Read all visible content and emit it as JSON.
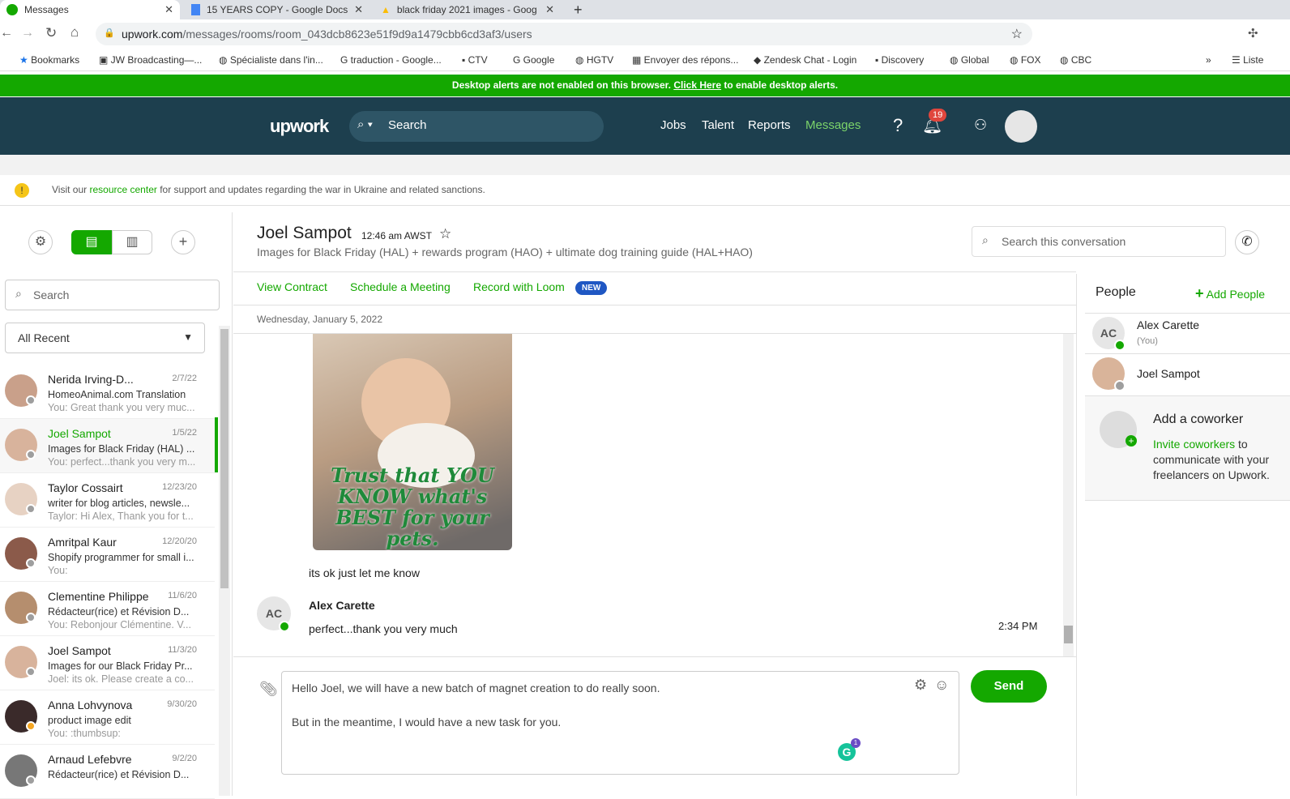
{
  "browser": {
    "tabs": [
      {
        "title": "Messages"
      },
      {
        "title": "15 YEARS COPY - Google Docs"
      },
      {
        "title": "black friday 2021 images - Goog"
      }
    ],
    "url_domain": "upwork.com",
    "url_path": "/messages/rooms/room_043dcb8623e51f9d9a1479cbb6cd3af3/users",
    "bookmarks": [
      "Bookmarks",
      "JW Broadcasting—...",
      "Spécialiste dans l'in...",
      "traduction - Google...",
      "CTV",
      "Google",
      "HGTV",
      "Envoyer des répons...",
      "Zendesk Chat - Login",
      "Discovery",
      "Global",
      "FOX",
      "CBC",
      "Liste"
    ],
    "more": "»"
  },
  "alert": {
    "text": "Desktop alerts are not enabled on this browser.",
    "link": "Click Here",
    "suffix": "to enable desktop alerts."
  },
  "header": {
    "logo": "upwork",
    "search_placeholder": "Search",
    "nav": [
      "Jobs",
      "Talent",
      "Reports",
      "Messages"
    ],
    "help": "?",
    "notifications": "19"
  },
  "notice": {
    "prefix": "Visit our",
    "link": "resource center",
    "suffix": "for support and updates regarding the war in Ukraine and related sanctions."
  },
  "sidebar": {
    "search_placeholder": "Search",
    "filter": "All Recent",
    "rooms": [
      {
        "name": "Nerida Irving-D...",
        "date": "2/7/22",
        "subject": "HomeoAnimal.com Translation",
        "preview": "You: Great thank you very muc..."
      },
      {
        "name": "Joel Sampot",
        "date": "1/5/22",
        "subject": "Images for Black Friday (HAL) ...",
        "preview": "You: perfect...thank you very m..."
      },
      {
        "name": "Taylor Cossairt",
        "date": "12/23/20",
        "subject": "writer for blog articles, newsle...",
        "preview": "Taylor: Hi Alex, Thank you for t..."
      },
      {
        "name": "Amritpal Kaur",
        "date": "12/20/20",
        "subject": "Shopify programmer for small i...",
        "preview": "You:"
      },
      {
        "name": "Clementine Philippe",
        "date": "11/6/20",
        "subject": "Rédacteur(rice) et Révision D...",
        "preview": "You: Rebonjour Clémentine. V..."
      },
      {
        "name": "Joel Sampot",
        "date": "11/3/20",
        "subject": "Images for our Black Friday Pr...",
        "preview": "Joel: its ok. Please create a co..."
      },
      {
        "name": "Anna Lohvynova",
        "date": "9/30/20",
        "subject": "product image edit",
        "preview": "You: :thumbsup:"
      },
      {
        "name": "Arnaud Lefebvre",
        "date": "9/2/20",
        "subject": "Rédacteur(rice) et Révision D...",
        "preview": ""
      }
    ]
  },
  "conversation": {
    "name": "Joel Sampot",
    "time": "12:46 am AWST",
    "subject": "Images for Black Friday (HAL) + rewards program (HAO) + ultimate dog training guide (HAL+HAO)",
    "search_placeholder": "Search this conversation",
    "actions": [
      "View Contract",
      "Schedule a Meeting",
      "Record with Loom"
    ],
    "new_badge": "NEW",
    "date_divider": "Wednesday, January 5, 2022",
    "image_caption": "Trust that YOU KNOW what's BEST for your pets.",
    "messages": [
      {
        "text": "its ok just let me know"
      },
      {
        "sender": "Alex Carette",
        "initials": "AC",
        "text": "perfect...thank you very much",
        "time": "2:34 PM"
      }
    ],
    "draft_line1": "Hello Joel, we will have a new batch of magnet creation to do really soon.",
    "draft_line2": "But in the meantime, I would have a new task for you.",
    "send": "Send",
    "grammarly_count": "1"
  },
  "people": {
    "title": "People",
    "add": "Add People",
    "members": [
      {
        "initials": "AC",
        "name": "Alex Carette",
        "note": "(You)"
      },
      {
        "name": "Joel Sampot"
      }
    ],
    "coworker_title": "Add a coworker",
    "coworker_link": "Invite coworkers",
    "coworker_text": "to communicate with your freelancers on Upwork."
  }
}
